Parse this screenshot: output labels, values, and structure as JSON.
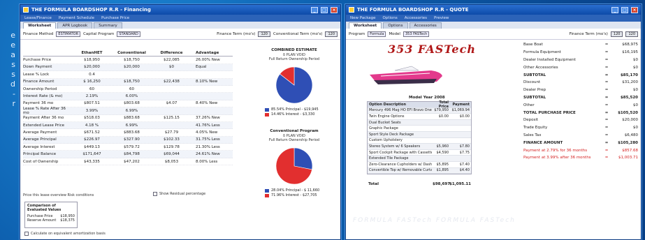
{
  "side_text": [
    "e",
    "e",
    "a",
    "s",
    "s",
    "d",
    "-",
    "r"
  ],
  "left_window": {
    "title": "THE FORMULA BOARDSHOP R.R  - Financing",
    "menus": [
      "Lease/Finance",
      "Payment Schedule",
      "Purchase Price"
    ],
    "tabs": [
      "Worksheet",
      "APR Logbook",
      "Summary"
    ],
    "toolbar": {
      "method_label": "Finance Method",
      "method_value": "ESTIMATOR",
      "cashflow_label": "Capital Program",
      "cashflow_value": "STANDARD",
      "group_label": "Finance Term (mo's)",
      "group_value": "120",
      "amount_label": "Conventional Term (mo's)",
      "amount_value": "120"
    },
    "columns": [
      "",
      "EthanHET",
      "Conventional",
      "Difference",
      "Advantage"
    ],
    "rows": [
      [
        "Purchase Price",
        "$18,950",
        "$18,750",
        "$22,085",
        "26.00% New"
      ],
      [
        "Down Payment",
        "$20,000",
        "$20,000",
        "$0",
        "Equal"
      ],
      [
        "Lease % Lock",
        "0.4",
        "",
        "",
        ""
      ],
      [
        "Finance Amount",
        "$ 16,250",
        "$18,750",
        "$22,438",
        "8.10% New"
      ],
      [
        "Ownership Period",
        "60",
        "60",
        "",
        ""
      ],
      [
        "Interest Rate (& mo)",
        "2.19%",
        "6.00%",
        "",
        ""
      ],
      [
        "Payment 36 mo",
        "$807.51",
        "$803.68",
        "$4.07",
        "8.40% New"
      ],
      [
        "Lease % Rate After 36 mo",
        "3.99%",
        "6.99%",
        "",
        ""
      ],
      [
        "Payment After 36 mo",
        "$518.03",
        "$883.68",
        "$125.15",
        "37.26% New"
      ],
      [
        "Extended Lease Price",
        "4.18 %",
        "6.99%",
        "",
        "41.76% Less"
      ],
      [
        "Average Payment",
        "$671.52",
        "$883.68",
        "$27.79",
        "4.05% New"
      ],
      [
        "Average Principal",
        "$226.97",
        "$327.90",
        "$102.33",
        "31.75% Less"
      ],
      [
        "Average Interest",
        "$449.13",
        "$579.72",
        "$129.78",
        "21.30% Less"
      ],
      [
        "Principal Balance",
        "$171,647",
        "$84,798",
        "$69,044",
        "24.61% New"
      ],
      [
        "Cost of Ownership",
        "$43,335",
        "$47,202",
        "$8,053",
        "8.00% Less"
      ]
    ],
    "footnote": "Price this lease overview Risk conditions",
    "subpanel": {
      "title": "Comparison of Evaluated Values",
      "lines": [
        [
          "Purchase Price",
          "$18,950"
        ],
        [
          "Reserve Amount",
          "$18,375"
        ]
      ]
    },
    "show_checkbox_label": "Show Residual percentage",
    "bottom_checkbox_label": "Calculate on equivalent amortization basis",
    "pie1": {
      "title": "COMBINED ESTIMATE",
      "subtitle1": "δ PLAN VOID",
      "subtitle2": "Full Return Ownership Period",
      "legend": [
        {
          "label": "85.54% Principal - $19,945",
          "color": "#2f4fb5"
        },
        {
          "label": "14.46% Interest - $3,330",
          "color": "#e22f2f"
        }
      ],
      "slices": [
        85.54,
        14.46
      ]
    },
    "pie2": {
      "title": "Conventional Program",
      "subtitle1": "δ PLAN VOID",
      "subtitle2": "Full Return Ownership Period",
      "legend": [
        {
          "label": "28.04% Principal - $ 11,660",
          "color": "#2f4fb5"
        },
        {
          "label": "71.96% Interest - $27,705",
          "color": "#e22f2f"
        }
      ],
      "slices": [
        28.04,
        71.96
      ]
    },
    "colors": {
      "blue": "#2f4fb5",
      "red": "#e22f2f"
    }
  },
  "right_window": {
    "title": "THE FORMULA BOARDSHOP R.R  - QUOTE",
    "menus": [
      "New Package",
      "Options",
      "Accessories",
      "Preview"
    ],
    "tabs": [
      "Worksheet",
      "Options",
      "Accessories"
    ],
    "toolbar": {
      "program_label": "Program",
      "program_value": "Formula",
      "model_label": "Model",
      "model_value": "353 FASTech",
      "finance_label": "Finance Term (mo's)",
      "finance_value": "120",
      "t2": "120"
    },
    "logo": "353 FASTech",
    "model_year": "Model Year 2008",
    "option_headers": [
      "Option Description",
      "Total Price",
      "Payment"
    ],
    "options": [
      [
        "Mercury 496 Mag HO EFI Bravo One XR",
        "$79,950",
        "$1,069.94"
      ],
      [
        "Twin Engine Options",
        "$0.00",
        "$0.00"
      ],
      [
        "Dual Bucket Seats",
        "",
        ""
      ],
      [
        "Graphic Package",
        "",
        ""
      ],
      [
        "Sport Style Deck Package",
        "",
        ""
      ],
      [
        "Custom Upholstery",
        "",
        ""
      ],
      [
        "Stereo System w/ 6 Speakers",
        "$5,960",
        "$7.80"
      ],
      [
        "Sport Cockpit Package with Cassette",
        "$4,590",
        "$7.75"
      ],
      [
        "Extended Tile Package",
        "",
        ""
      ],
      [
        "Zero-Clearance Cupholders w/ Dash Storage",
        "$5,895",
        "$7.40"
      ],
      [
        "Convertible Top w/ Removable Curtain",
        "$1,895",
        "$4.40"
      ]
    ],
    "total_label": "Total",
    "total_price": "$98,697",
    "total_payment": "$1,095.11",
    "price_rows": [
      {
        "label": "Base Boat",
        "val": "$68,975",
        "style": ""
      },
      {
        "label": "Formula Equipment",
        "val": "$16,195",
        "style": ""
      },
      {
        "label": "Dealer Installed Equipment",
        "val": "$0",
        "style": ""
      },
      {
        "label": "Other Accessories",
        "val": "$0",
        "style": ""
      },
      {
        "label": "SUBTOTAL",
        "val": "$85,170",
        "style": "bold"
      },
      {
        "label": "Discount",
        "val": "$31,200",
        "style": ""
      },
      {
        "label": "Dealer Prep",
        "val": "$0",
        "style": ""
      },
      {
        "label": "SUBTOTAL",
        "val": "$85,520",
        "style": "bold"
      },
      {
        "label": "Other",
        "val": "$0",
        "style": ""
      },
      {
        "label": "TOTAL PURCHASE PRICE",
        "val": "$105,520",
        "style": "bold"
      },
      {
        "label": "Deposit",
        "val": "$20,000",
        "style": ""
      },
      {
        "label": "Trade Equity",
        "val": "$0",
        "style": ""
      },
      {
        "label": "Sales Tax",
        "val": "$6,480",
        "style": ""
      },
      {
        "label": "FINANCE AMOUNT",
        "val": "$105,280",
        "style": "bold"
      },
      {
        "label": "Payment at 2.79% for 36 months",
        "val": "$857.68",
        "style": "red"
      },
      {
        "label": "Payment at 3.99% after 36 months",
        "val": "$1,003.71",
        "style": "red"
      }
    ],
    "watermark": "FORMULA FASTech FORMULA FASTech"
  }
}
